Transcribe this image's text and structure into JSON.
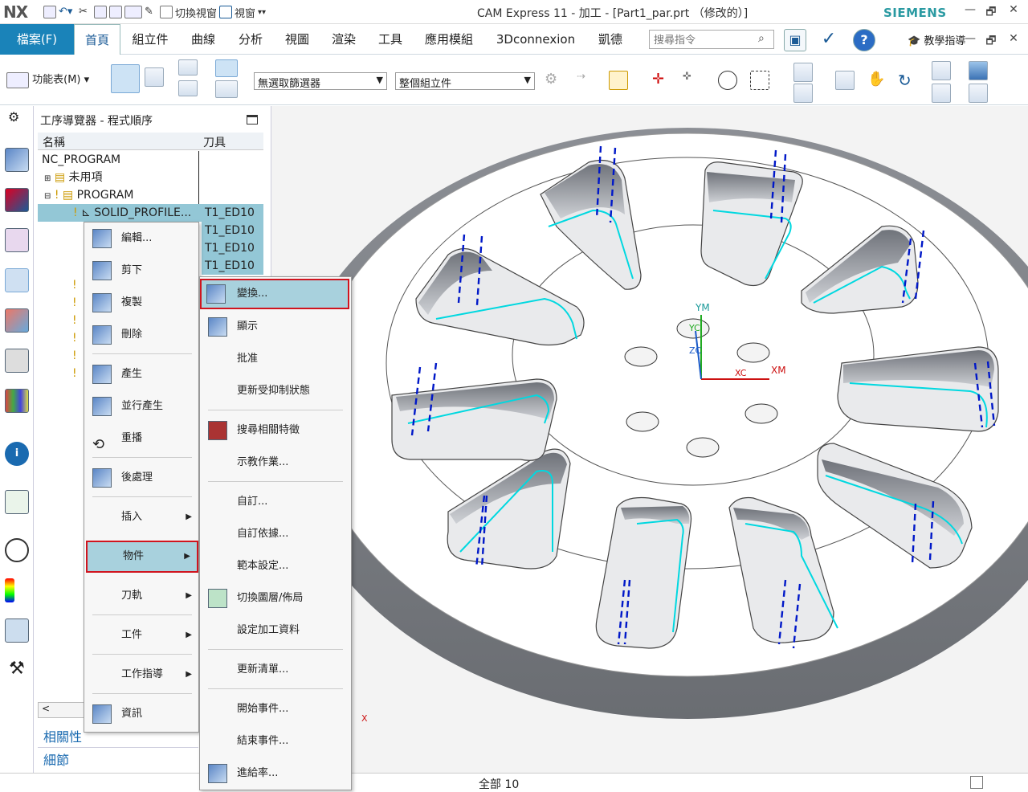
{
  "app": {
    "logo": "NX",
    "title": "CAM Express 11 - 加工 - [Part1_par.prt （修改的）]",
    "brand": "SIEMENS"
  },
  "quick_access": {
    "switch_view": "切換視窗",
    "window": "視窗"
  },
  "window_controls": {
    "minimize": "—",
    "restore": "🗗",
    "close": "✕"
  },
  "tabs": {
    "file": "檔案(F)",
    "items": [
      "首頁",
      "組立件",
      "曲線",
      "分析",
      "視圖",
      "渲染",
      "工具",
      "應用模組",
      "3Dconnexion",
      "凱德"
    ]
  },
  "search": {
    "placeholder": "搜尋指令"
  },
  "teach": "教學指導",
  "toolbar": {
    "function_list": "功能表(M)",
    "filter": "無選取篩選器",
    "assembly": "整個組立件"
  },
  "navigator": {
    "title": "工序導覽器 - 程式順序",
    "col_name": "名稱",
    "col_tool": "刀具",
    "rows": [
      {
        "name": "NC_PROGRAM",
        "tool": ""
      },
      {
        "name": "未用項",
        "tool": ""
      },
      {
        "name": "PROGRAM",
        "tool": ""
      },
      {
        "name": "SOLID_PROFILE...",
        "tool": "T1_ED10"
      },
      {
        "name": "",
        "tool": "T1_ED10"
      },
      {
        "name": "",
        "tool": "T1_ED10"
      },
      {
        "name": "",
        "tool": "T1_ED10"
      }
    ],
    "related": "相關性",
    "details": "細節"
  },
  "context_menu": {
    "items": [
      "編輯...",
      "剪下",
      "複製",
      "刪除",
      "產生",
      "並行產生",
      "重播",
      "後處理",
      "插入",
      "物件",
      "刀軌",
      "工件",
      "工作指導",
      "資訊"
    ]
  },
  "sub_menu": {
    "items": [
      "變換...",
      "顯示",
      "批准",
      "更新受抑制狀態",
      "搜尋相關特徵",
      "示教作業...",
      "自訂...",
      "自訂依據...",
      "範本設定...",
      "切換圖層/佈局",
      "設定加工資料",
      "更新清單...",
      "開始事件...",
      "結束事件...",
      "進給率..."
    ]
  },
  "viewport": {
    "axis_y": "YM",
    "axis_x": "XM",
    "axis_xc": "XC",
    "axis_zc": "ZC",
    "axis_yc": "YC",
    "x_mark": "X"
  },
  "status": "全部 10",
  "colors": {
    "accent": "#1a83b9",
    "highlight": "#d0141e",
    "selection": "#93c7d6",
    "toolpath": "#00d8e0",
    "toolaxis": "#0018c8"
  }
}
